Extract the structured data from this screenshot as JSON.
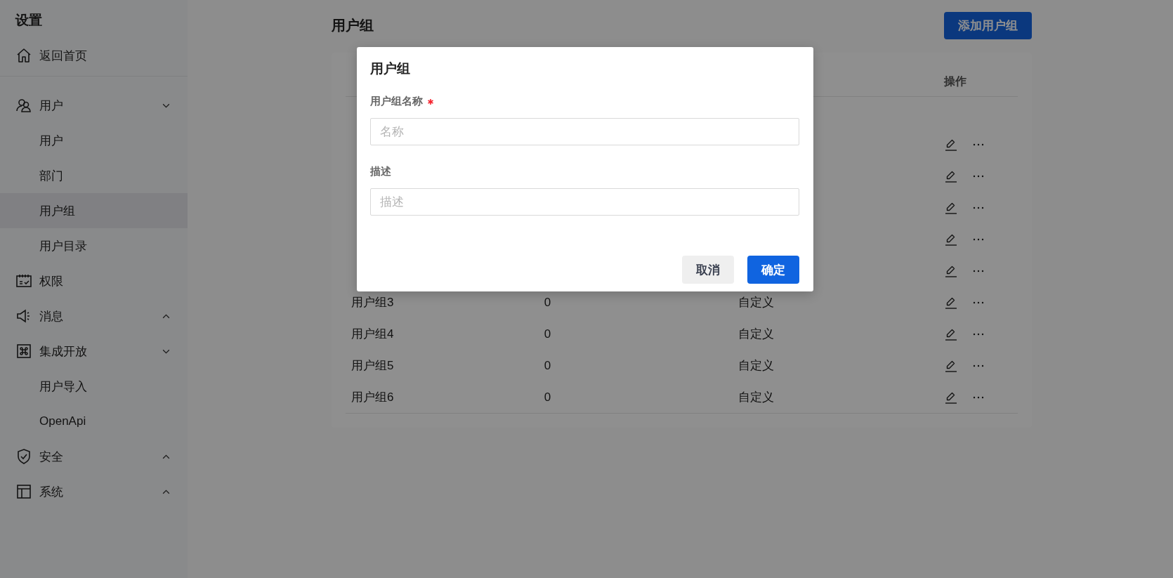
{
  "sidebar": {
    "title": "设置",
    "home": {
      "label": "返回首页"
    },
    "items": [
      {
        "label": "用户",
        "expanded": true,
        "children": [
          {
            "label": "用户",
            "selected": false
          },
          {
            "label": "部门",
            "selected": false
          },
          {
            "label": "用户组",
            "selected": true
          },
          {
            "label": "用户目录",
            "selected": false
          }
        ]
      },
      {
        "label": "权限"
      },
      {
        "label": "消息",
        "expanded": false
      },
      {
        "label": "集成开放",
        "expanded": true,
        "children": [
          {
            "label": "用户导入",
            "selected": false
          },
          {
            "label": "OpenApi",
            "selected": false
          }
        ]
      },
      {
        "label": "安全",
        "expanded": false
      },
      {
        "label": "系统",
        "expanded": false
      }
    ]
  },
  "page": {
    "title": "用户组",
    "add_button": "添加用户组"
  },
  "table": {
    "action_column": "操作",
    "rows": [
      {
        "actions": false
      },
      {
        "actions": true
      },
      {
        "actions": true
      },
      {
        "actions": true
      },
      {
        "actions": true
      },
      {
        "actions": true
      },
      {
        "name": "用户组3",
        "members": "0",
        "type": "自定义",
        "actions": true
      },
      {
        "name": "用户组4",
        "members": "0",
        "type": "自定义",
        "actions": true
      },
      {
        "name": "用户组5",
        "members": "0",
        "type": "自定义",
        "actions": true
      },
      {
        "name": "用户组6",
        "members": "0",
        "type": "自定义",
        "actions": true
      }
    ]
  },
  "dialog": {
    "title": "用户组",
    "fields": [
      {
        "label": "用户组名称",
        "required": true,
        "placeholder": "名称"
      },
      {
        "label": "描述",
        "required": false,
        "placeholder": "描述"
      }
    ],
    "buttons": [
      {
        "label": "取消",
        "kind": "secondary"
      },
      {
        "label": "确定",
        "kind": "primary"
      }
    ]
  }
}
